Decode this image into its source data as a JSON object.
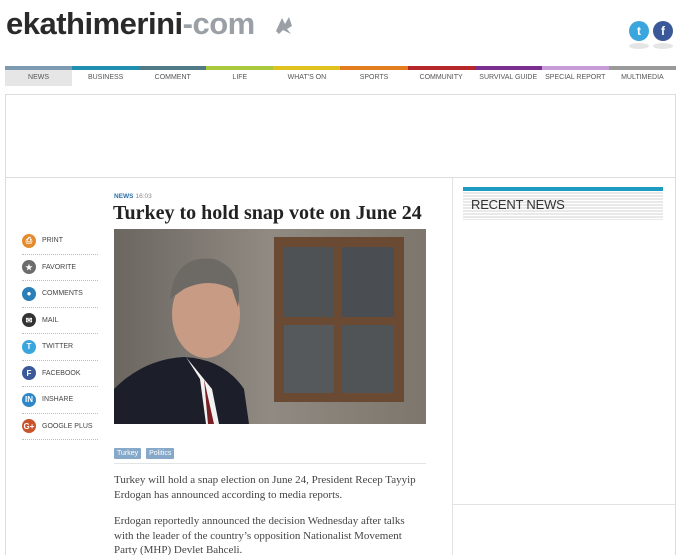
{
  "brand": {
    "name_main": "ekathimerini",
    "name_dash": "-",
    "name_com": "com"
  },
  "header_social": [
    {
      "name": "twitter",
      "glyph": "t",
      "color": "#3aa6dd"
    },
    {
      "name": "facebook",
      "glyph": "f",
      "color": "#3b5998"
    }
  ],
  "nav": [
    {
      "label": "NEWS",
      "color": "#7c9bb1",
      "active": true
    },
    {
      "label": "BUSINESS",
      "color": "#1e8fb0"
    },
    {
      "label": "COMMENT",
      "color": "#4f7a86"
    },
    {
      "label": "LIFE",
      "color": "#a9c93d"
    },
    {
      "label": "WHAT'S ON",
      "color": "#e0c21f"
    },
    {
      "label": "SPORTS",
      "color": "#e47d1d"
    },
    {
      "label": "COMMUNITY",
      "color": "#b52728"
    },
    {
      "label": "SURVIVAL GUIDE",
      "color": "#7a2e90"
    },
    {
      "label": "SPECIAL REPORT",
      "color": "#c79bd8"
    },
    {
      "label": "MULTIMEDIA",
      "color": "#9a9a9a"
    }
  ],
  "share": [
    {
      "label": "PRINT",
      "icon": "print-icon",
      "color": "#e58b2d",
      "glyph": "⎙"
    },
    {
      "label": "FAVORITE",
      "icon": "favorite-icon",
      "color": "#6c6c6c",
      "glyph": "★"
    },
    {
      "label": "COMMENTS",
      "icon": "comments-icon",
      "color": "#2a7fb8",
      "glyph": "●"
    },
    {
      "label": "MAIL",
      "icon": "mail-icon",
      "color": "#333333",
      "glyph": "✉"
    },
    {
      "label": "TWITTER",
      "icon": "twitter-icon",
      "color": "#3aa6dd",
      "glyph": "t"
    },
    {
      "label": "FACEBOOK",
      "icon": "facebook-icon",
      "color": "#3b5998",
      "glyph": "f"
    },
    {
      "label": "INSHARE",
      "icon": "linkedin-icon",
      "color": "#2d87c8",
      "glyph": "in"
    },
    {
      "label": "GOOGLE PLUS",
      "icon": "google-plus-icon",
      "color": "#c9532b",
      "glyph": "g+"
    }
  ],
  "article": {
    "category": "NEWS",
    "time": "16:03",
    "headline": "Turkey to hold snap vote on June 24",
    "tags": [
      "Turkey",
      "Politics"
    ],
    "paragraphs": [
      "Turkey will hold a snap election on June 24, President Recep Tayyip Erdogan has announced according to media reports.",
      "Erdogan reportedly announced the decision Wednesday after talks with the leader of the country’s opposition Nationalist Movement Party (MHP) Devlet Bahceli."
    ]
  },
  "sidebar": {
    "recent_title": "RECENT NEWS"
  }
}
